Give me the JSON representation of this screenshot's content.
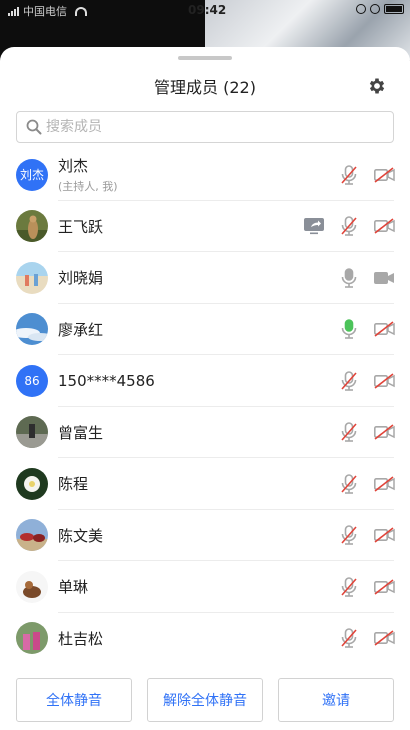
{
  "status_bar": {
    "carrier": "中国电信",
    "time": "09:42"
  },
  "header": {
    "title": "管理成员 (22)"
  },
  "search": {
    "placeholder": "搜索成员",
    "value": ""
  },
  "members": [
    {
      "name": "刘杰",
      "sub": "(主持人, 我)",
      "avatar_text": "刘杰",
      "avatar_type": "text",
      "mic": "muted",
      "camera": "off",
      "share": false
    },
    {
      "name": "王飞跃",
      "sub": "",
      "avatar_text": "",
      "avatar_type": "photo-meerkat",
      "mic": "muted",
      "camera": "off",
      "share": true
    },
    {
      "name": "刘晓娟",
      "sub": "",
      "avatar_text": "",
      "avatar_type": "photo-beach",
      "mic": "on",
      "camera": "on",
      "share": false
    },
    {
      "name": "廖承红",
      "sub": "",
      "avatar_text": "",
      "avatar_type": "photo-sky",
      "mic": "speaking",
      "camera": "off",
      "share": false
    },
    {
      "name": "150****4586",
      "sub": "",
      "avatar_text": "86",
      "avatar_type": "text",
      "mic": "muted",
      "camera": "off",
      "share": false
    },
    {
      "name": "曾富生",
      "sub": "",
      "avatar_text": "",
      "avatar_type": "photo-road",
      "mic": "muted",
      "camera": "off",
      "share": false
    },
    {
      "name": "陈程",
      "sub": "",
      "avatar_text": "",
      "avatar_type": "photo-flower",
      "mic": "muted",
      "camera": "off",
      "share": false
    },
    {
      "name": "陈文美",
      "sub": "",
      "avatar_text": "",
      "avatar_type": "photo-horses",
      "mic": "muted",
      "camera": "off",
      "share": false
    },
    {
      "name": "单琳",
      "sub": "",
      "avatar_text": "",
      "avatar_type": "photo-cartoon",
      "mic": "muted",
      "camera": "off",
      "share": false
    },
    {
      "name": "杜吉松",
      "sub": "",
      "avatar_text": "",
      "avatar_type": "photo-kids",
      "mic": "muted",
      "camera": "off",
      "share": false
    }
  ],
  "footer": {
    "mute_all": "全体静音",
    "unmute_all": "解除全体静音",
    "invite": "邀请"
  },
  "colors": {
    "accent": "#3072f6",
    "speaking": "#4cc35a",
    "icon_gray": "#a8a8a8",
    "slash_red": "#e0443a"
  }
}
